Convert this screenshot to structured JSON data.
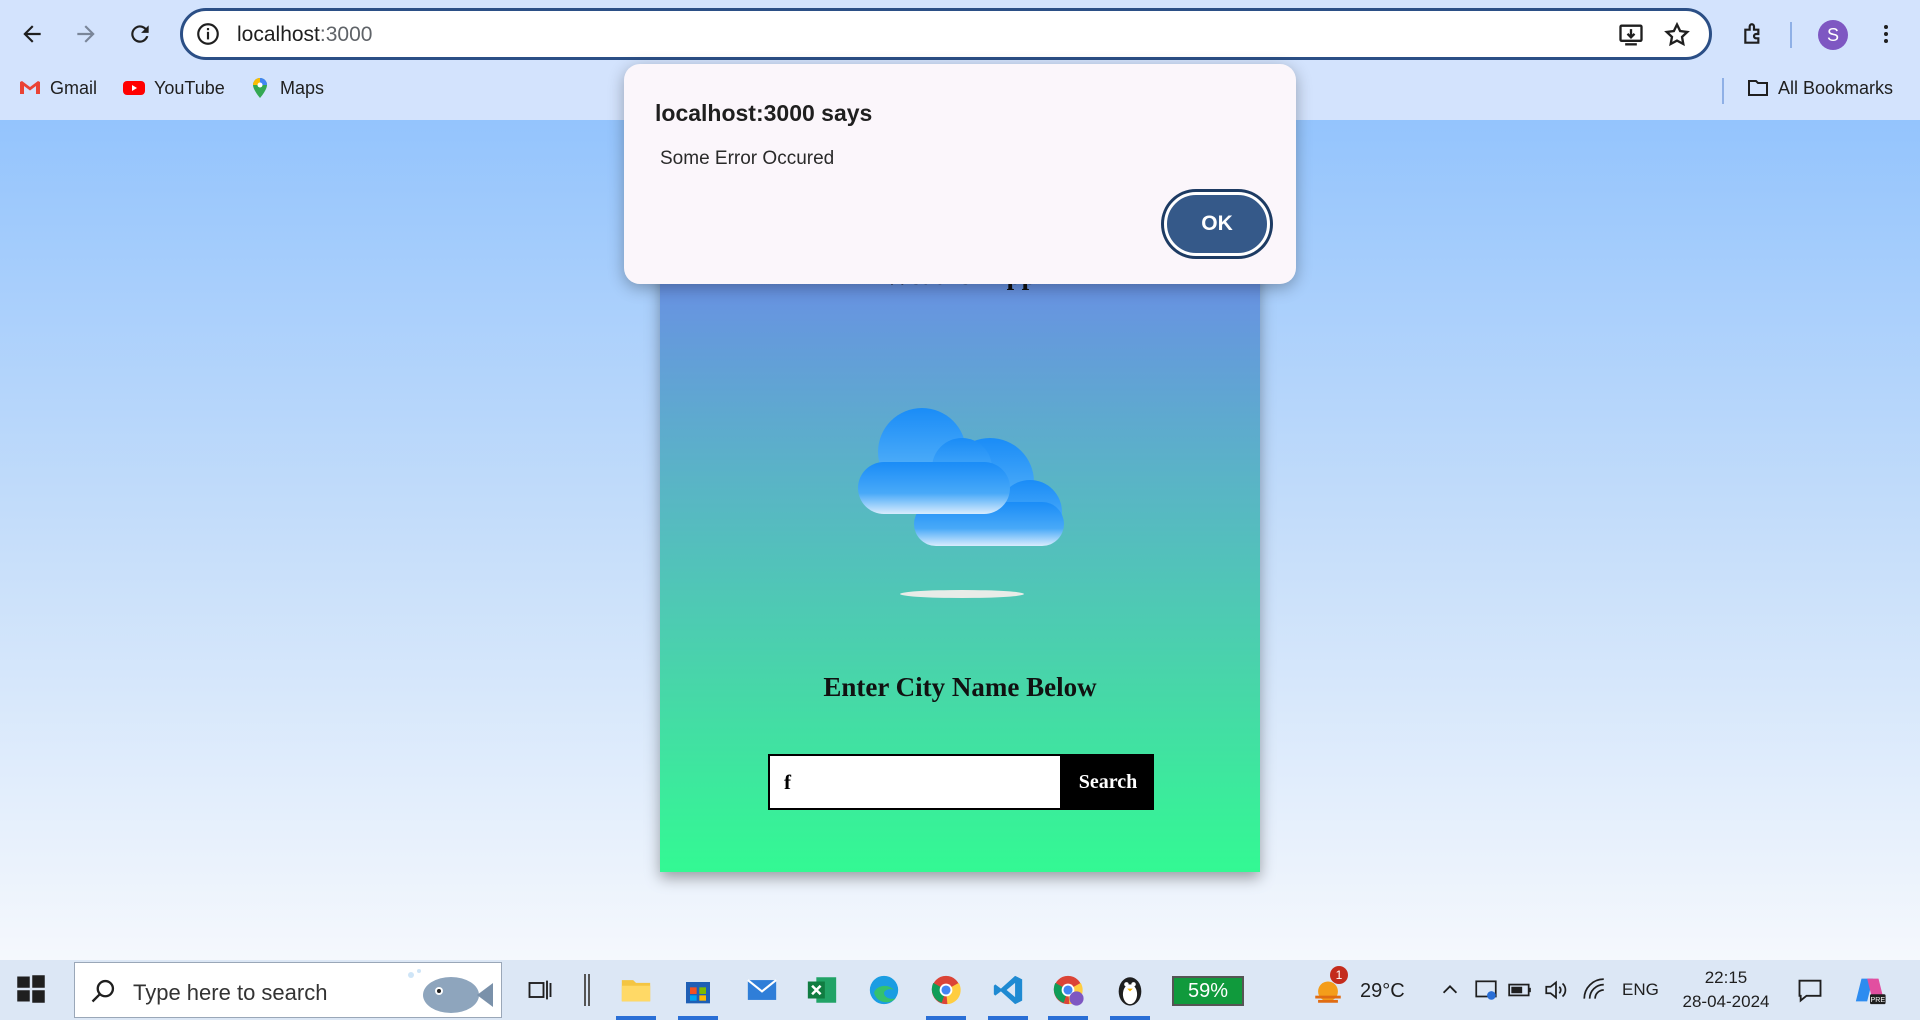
{
  "browser": {
    "url_host": "localhost",
    "url_port": ":3000",
    "profile_initial": "S",
    "bookmarks": [
      {
        "label": "Gmail",
        "icon": "gmail-icon"
      },
      {
        "label": "YouTube",
        "icon": "youtube-icon"
      },
      {
        "label": "Maps",
        "icon": "maps-icon"
      }
    ],
    "all_bookmarks_label": "All Bookmarks"
  },
  "app": {
    "title": "Weather App",
    "city_heading": "Enter City Name Below",
    "input_value": "f",
    "search_label": "Search"
  },
  "dialog": {
    "title": "localhost:3000 says",
    "message": "Some Error Occured",
    "ok_label": "OK"
  },
  "taskbar": {
    "search_placeholder": "Type here to search",
    "battery_widget": "59%",
    "weather_badge": "1",
    "temperature": "29°C",
    "language": "ENG",
    "time": "22:15",
    "date": "28-04-2024"
  },
  "colors": {
    "accent": "#355989",
    "page_top": "#94c4fd",
    "card_bottom": "#33f993"
  }
}
